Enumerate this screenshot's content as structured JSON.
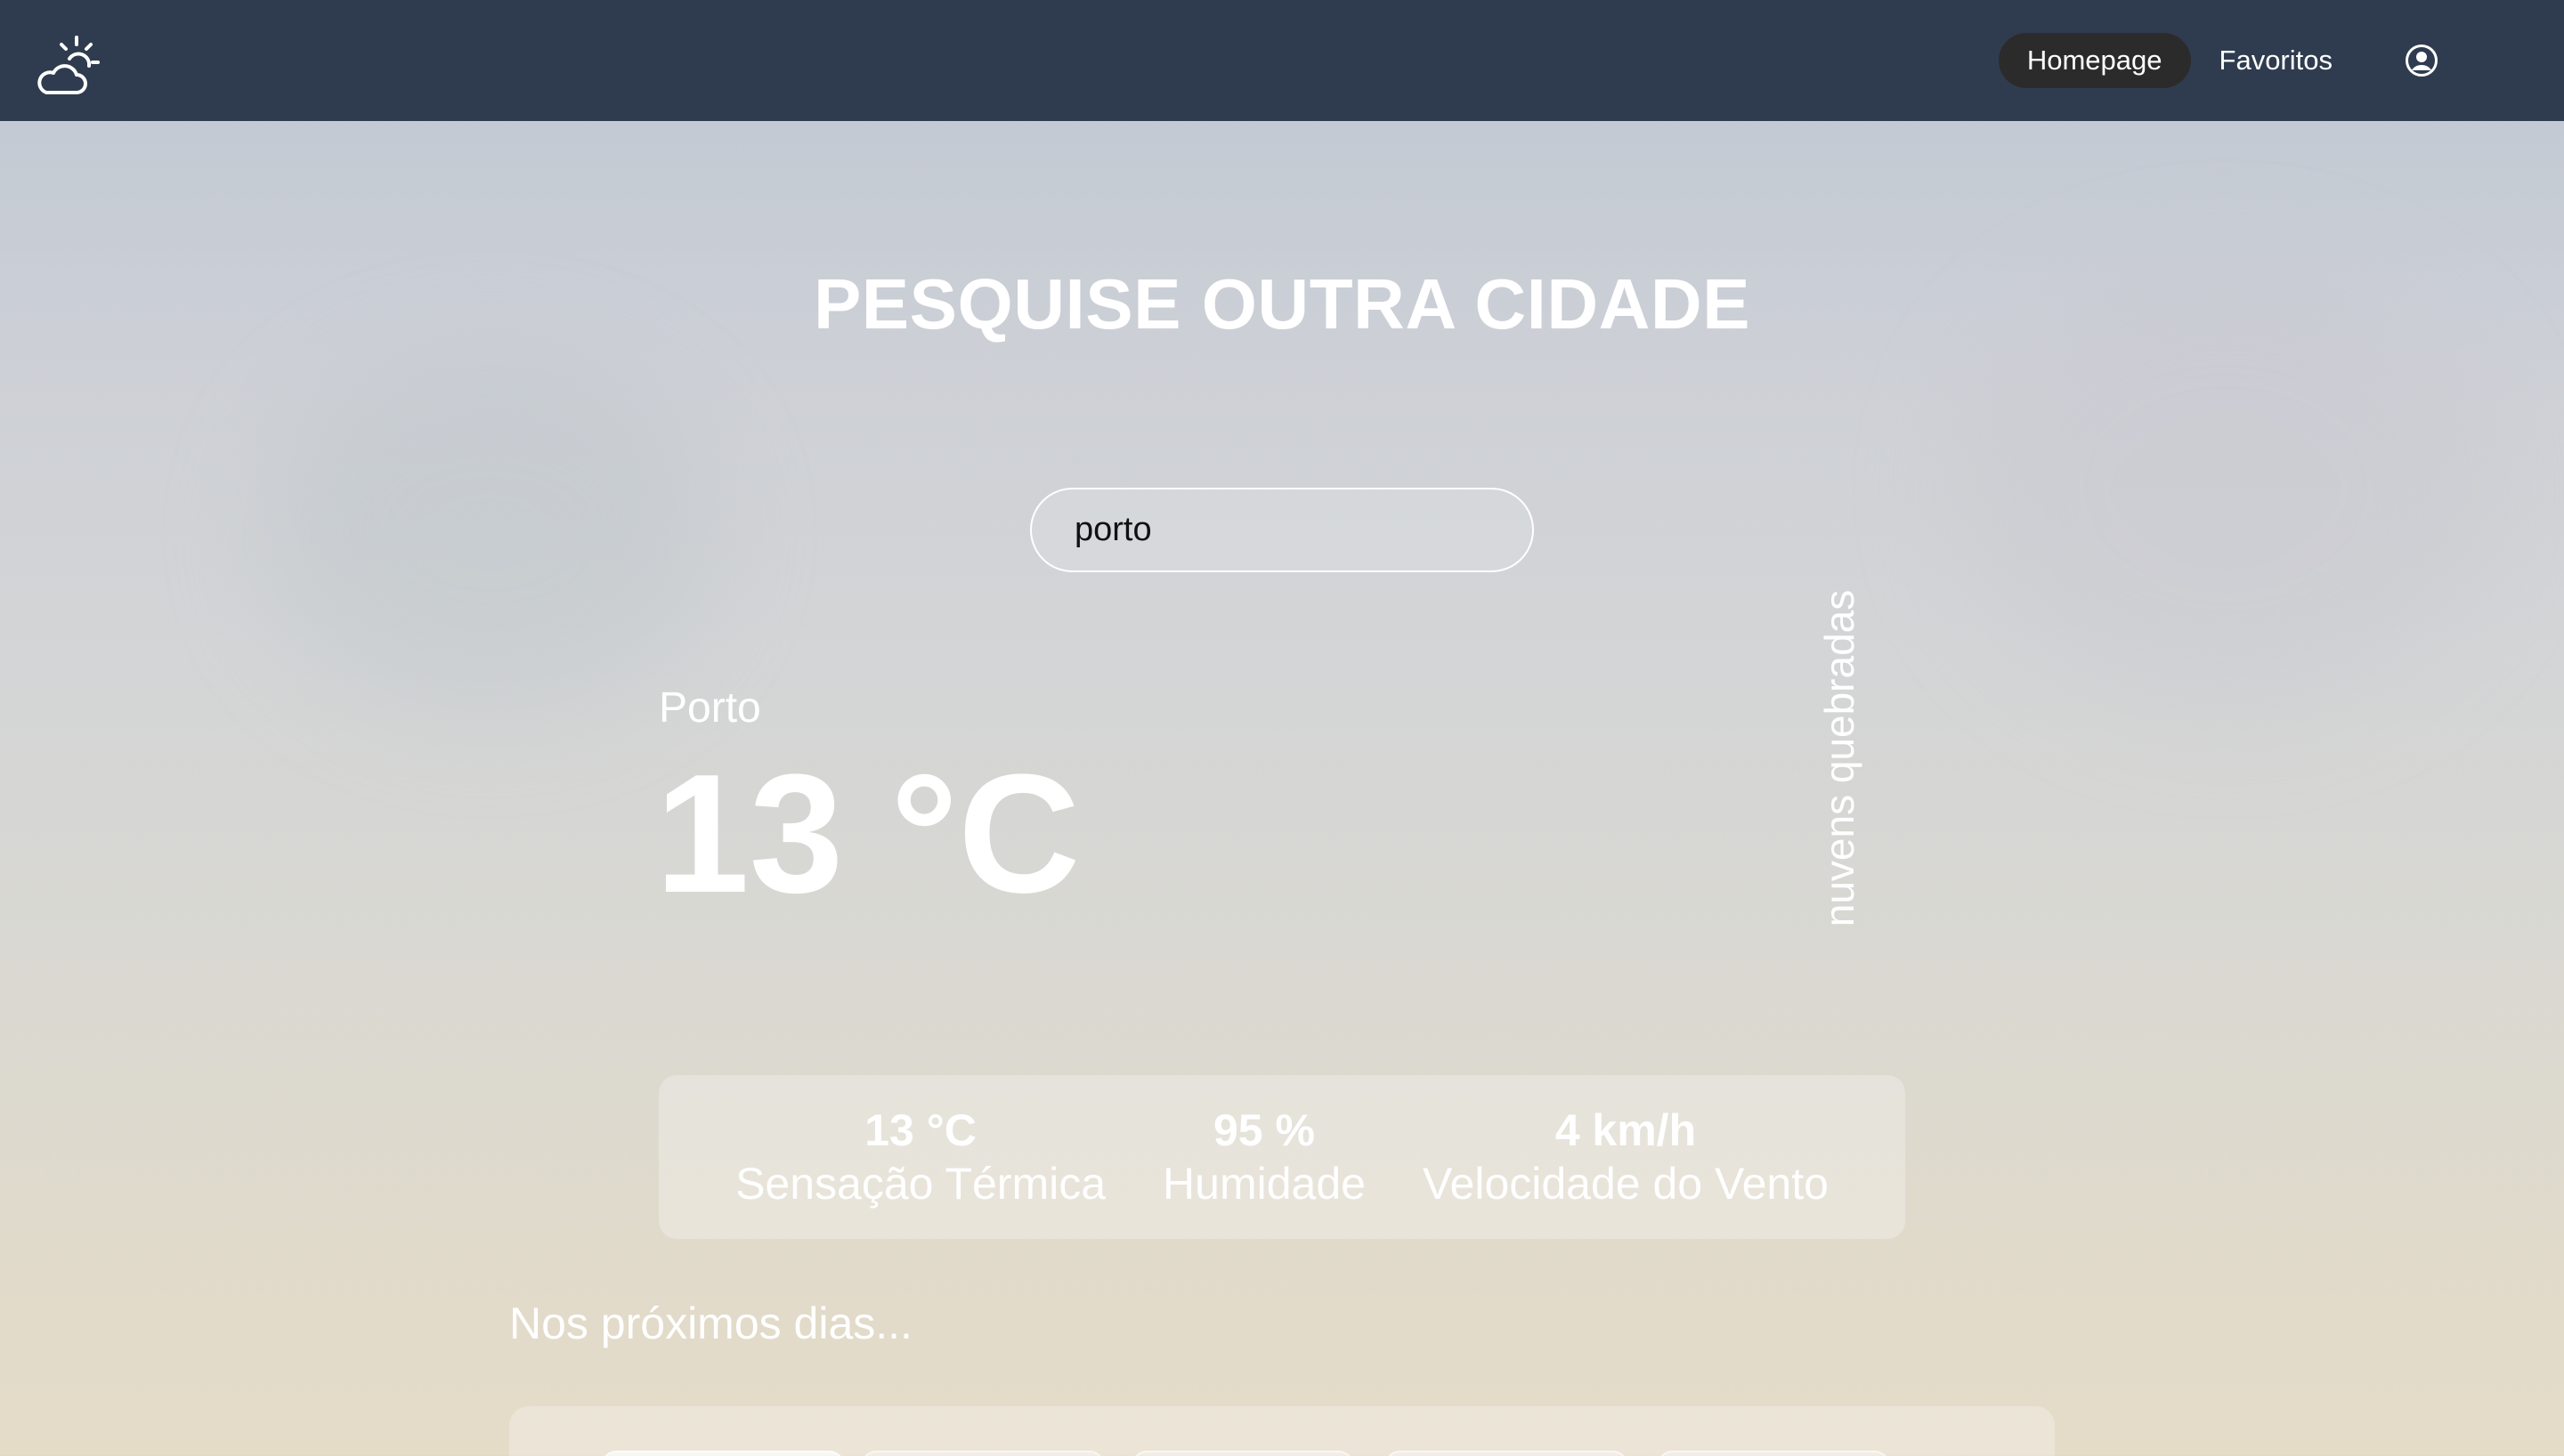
{
  "nav": {
    "logo_icon": "weather-cloud-sun-icon",
    "links": [
      {
        "label": "Homepage",
        "active": true
      },
      {
        "label": "Favoritos",
        "active": false
      }
    ],
    "account_icon": "user-circle-icon"
  },
  "search": {
    "title": "PESQUISE OUTRA CIDADE",
    "value": "porto"
  },
  "weather": {
    "city": "Porto",
    "temperature": "13 °C",
    "condition": "nuvens quebradas",
    "stats": [
      {
        "value": "13 °C",
        "label": "Sensação Térmica"
      },
      {
        "value": "95 %",
        "label": "Humidade"
      },
      {
        "value": "4 km/h",
        "label": "Velocidade do Vento"
      }
    ]
  },
  "forecast": {
    "heading": "Nos próximos dias..."
  },
  "colors": {
    "navbar": "#2f3c4f",
    "active_pill": "#2b2b2b",
    "text": "#ffffff"
  }
}
